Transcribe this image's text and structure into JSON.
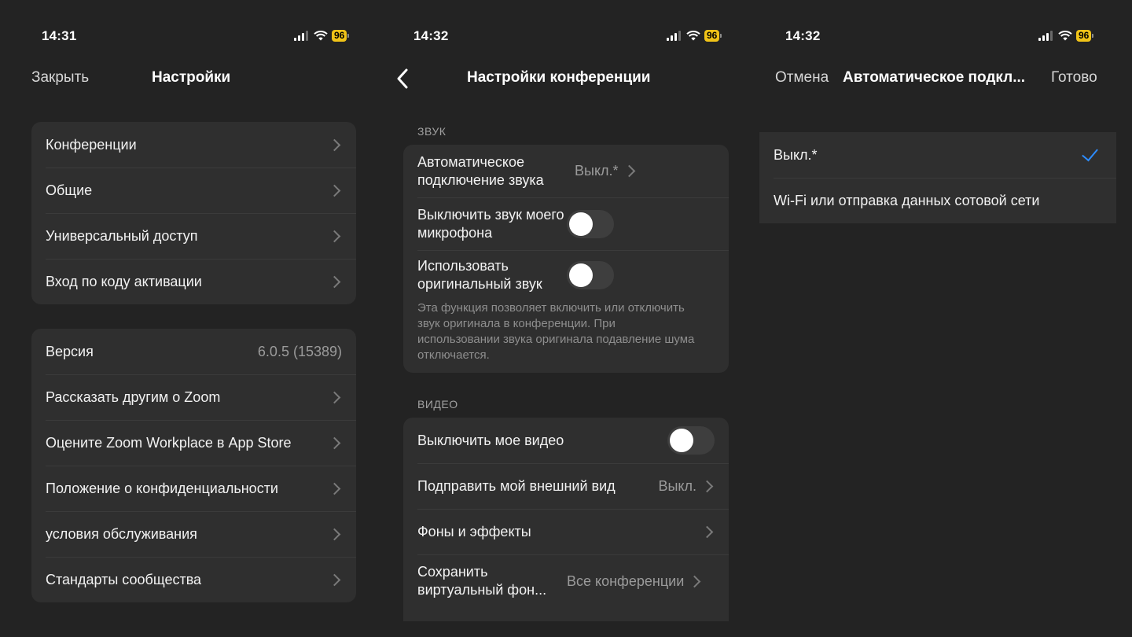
{
  "screen1": {
    "status": {
      "time": "14:31",
      "battery": "96"
    },
    "nav": {
      "close": "Закрыть",
      "title": "Настройки"
    },
    "group1": [
      {
        "label": "Конференции"
      },
      {
        "label": "Общие"
      },
      {
        "label": "Универсальный доступ"
      },
      {
        "label": "Вход по коду активации"
      }
    ],
    "group2": [
      {
        "label": "Версия",
        "value": "6.0.5 (15389)"
      },
      {
        "label": "Рассказать другим о Zoom"
      },
      {
        "label": "Оцените Zoom Workplace в App Store"
      },
      {
        "label": "Положение о конфиденциальности"
      },
      {
        "label": "условия обслуживания"
      },
      {
        "label": "Стандарты сообщества"
      }
    ]
  },
  "screen2": {
    "status": {
      "time": "14:32",
      "battery": "96"
    },
    "nav": {
      "title": "Настройки конференции"
    },
    "sound": {
      "header": "ЗВУК",
      "auto_audio": {
        "label": "Автоматическое подключение звука",
        "value": "Выкл.*"
      },
      "mute_mic": {
        "label": "Выключить звук моего микрофона",
        "on": false
      },
      "original_sound": {
        "label": "Использовать оригинальный звук",
        "on": false
      },
      "description": "Эта функция позволяет включить или отключить звук оригинала в конференции. При использовании звука оригинала подавление шума отключается."
    },
    "video": {
      "header": "ВИДЕО",
      "turn_off_video": {
        "label": "Выключить мое видео",
        "on": false
      },
      "touch_up": {
        "label": "Подправить мой внешний вид",
        "value": "Выкл."
      },
      "backgrounds": {
        "label": "Фоны и эффекты"
      },
      "save_vb": {
        "label": "Сохранить виртуальный фон...",
        "value": "Все конференции"
      }
    }
  },
  "screen3": {
    "status": {
      "time": "14:32",
      "battery": "96"
    },
    "nav": {
      "cancel": "Отмена",
      "title": "Автоматическое подкл...",
      "done": "Готово"
    },
    "options": [
      {
        "label": "Выкл.*",
        "selected": true
      },
      {
        "label": "Wi-Fi или отправка данных сотовой сети",
        "selected": false
      }
    ]
  },
  "icons": {
    "signal": "signal-icon",
    "wifi": "wifi-icon",
    "battery": "battery-icon",
    "back": "back-chevron-icon",
    "check": "checkmark-icon"
  },
  "colors": {
    "background": "#232323",
    "card": "#2f2f2f",
    "accent": "#2d8cff",
    "battery": "#f0c318"
  }
}
